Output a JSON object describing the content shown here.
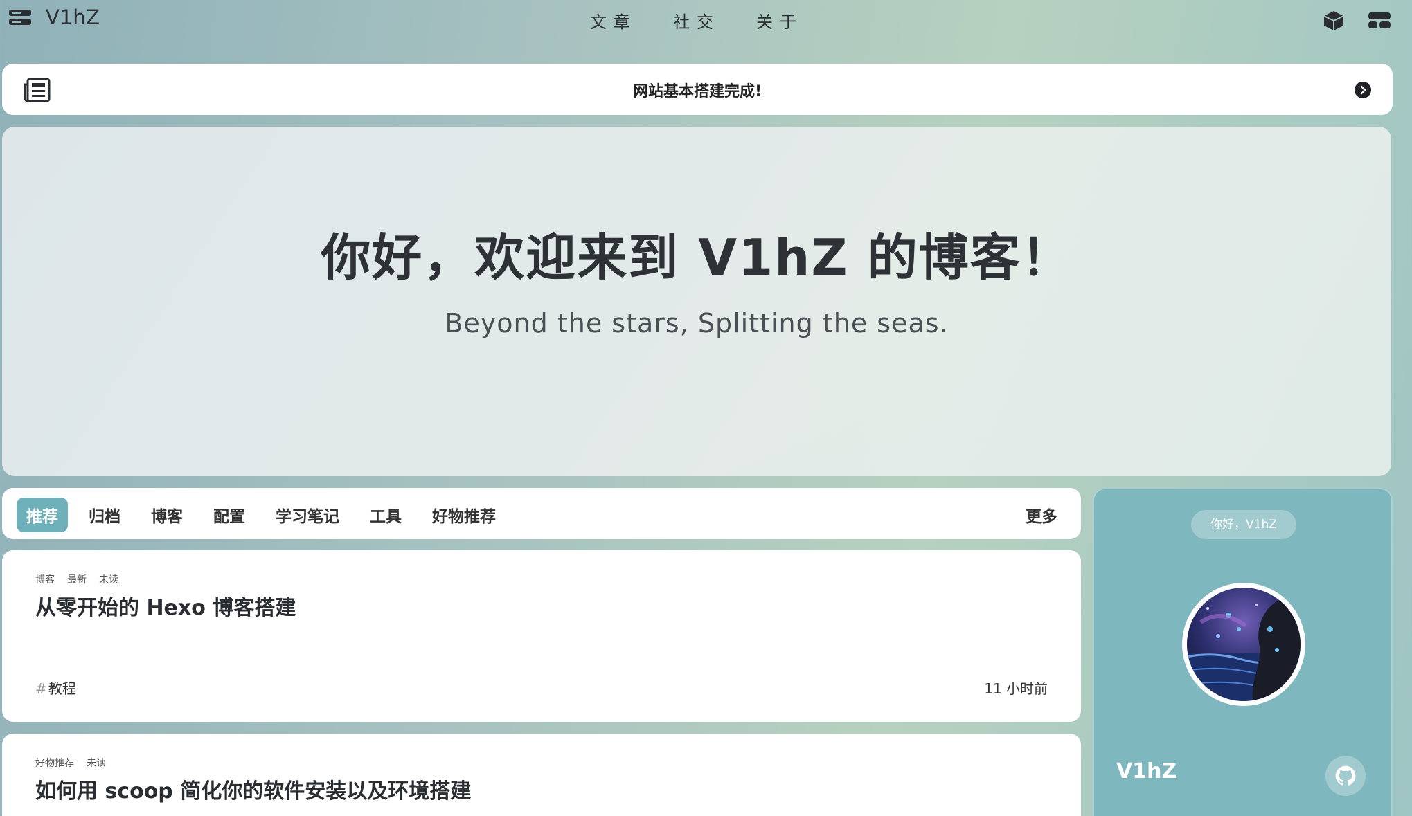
{
  "nav": {
    "brand": "V1hZ",
    "links": [
      "文章",
      "社交",
      "关于"
    ]
  },
  "announcement": {
    "text": "网站基本搭建完成!"
  },
  "hero": {
    "title": "你好，欢迎来到 V1hZ 的博客！",
    "subtitle": "Beyond the stars, Splitting the seas."
  },
  "categories": {
    "tabs": [
      "推荐",
      "归档",
      "博客",
      "配置",
      "学习笔记",
      "工具",
      "好物推荐"
    ],
    "active": "推荐",
    "more": "更多"
  },
  "posts": [
    {
      "meta": [
        "博客",
        "最新",
        "未读"
      ],
      "title": "从零开始的 Hexo 博客搭建",
      "tag": "教程",
      "time": "11 小时前"
    },
    {
      "meta": [
        "好物推荐",
        "未读"
      ],
      "title": "如何用 scoop 简化你的软件安装以及环境搭建"
    }
  ],
  "profile": {
    "greeting": "你好，V1hZ",
    "name": "V1hZ"
  },
  "colors": {
    "accent": "#6fb1ba",
    "profile_bg": "#7eb7bd"
  },
  "icons": {
    "menu": "menu-icon",
    "cube": "cube-icon",
    "layout": "layout-icon",
    "newspaper": "newspaper-icon",
    "arrow": "arrow-right-circle-icon",
    "github": "github-icon"
  }
}
